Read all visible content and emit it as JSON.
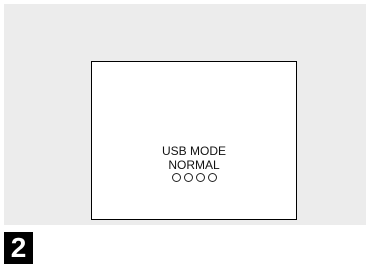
{
  "screen": {
    "line1": "USB MODE",
    "line2": "NORMAL",
    "dot_count": 4
  },
  "step": {
    "number": "2"
  },
  "colors": {
    "panel_background": "#ececec",
    "screen_background": "#ffffff",
    "screen_border": "#000000",
    "badge_background": "#000000",
    "badge_text": "#ffffff"
  }
}
